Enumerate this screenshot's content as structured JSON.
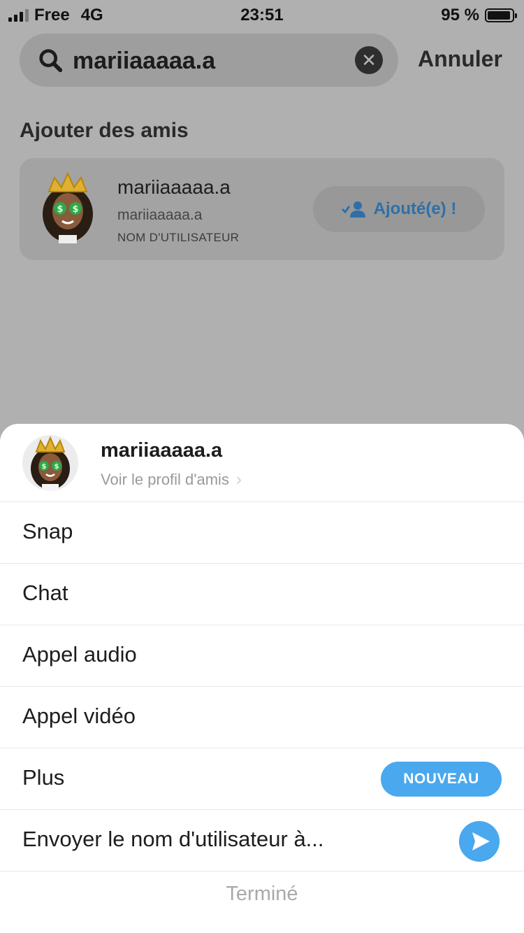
{
  "status_bar": {
    "carrier": "Free",
    "network": "4G",
    "time": "23:51",
    "battery": "95 %",
    "battery_level": 0.95
  },
  "search": {
    "query": "mariiaaaaa.a",
    "cancel_label": "Annuler"
  },
  "add_friends": {
    "section_title": "Ajouter des amis",
    "result": {
      "display_name": "mariiaaaaa.a",
      "username": "mariiaaaaa.a",
      "subtitle": "NOM D'UTILISATEUR",
      "added_label": "Ajouté(e) !"
    }
  },
  "sheet": {
    "name": "mariiaaaaa.a",
    "profile_link": "Voir le profil d'amis",
    "items": [
      {
        "label": "Snap"
      },
      {
        "label": "Chat"
      },
      {
        "label": "Appel audio"
      },
      {
        "label": "Appel vidéo"
      },
      {
        "label": "Plus",
        "badge": "NOUVEAU"
      },
      {
        "label": "Envoyer le nom d'utilisateur à..."
      }
    ],
    "done_label": "Terminé"
  },
  "colors": {
    "accent": "#49a8ee",
    "added_text": "#2f6fa8",
    "overlay": "#b0b0b0"
  }
}
